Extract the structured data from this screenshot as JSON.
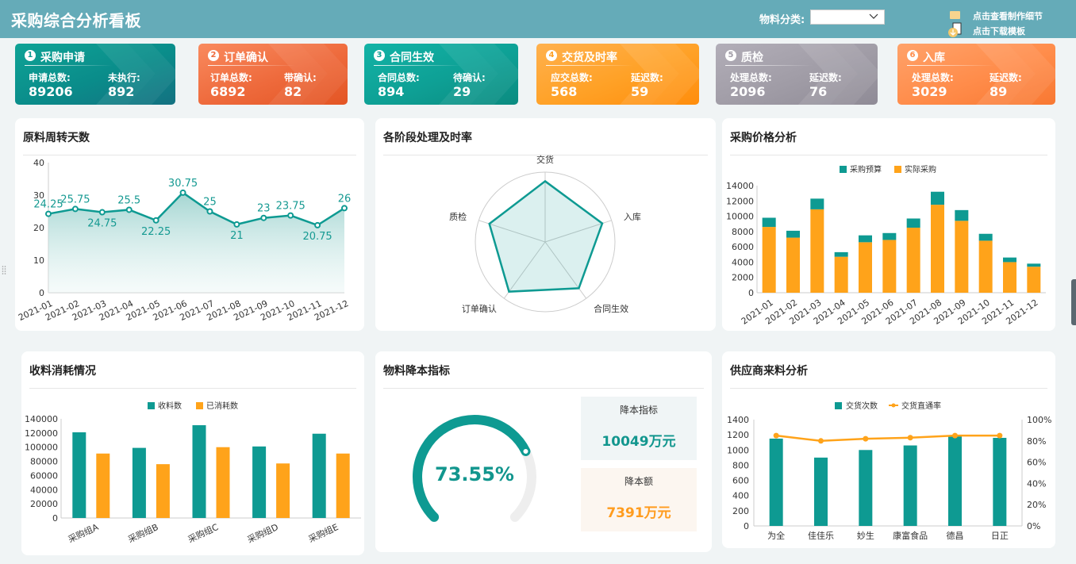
{
  "header": {
    "title": "采购综合分析看板",
    "filter_label": "物料分类:",
    "filter_value": "",
    "link_detail": "点击查看制作细节",
    "link_download": "点击下载模板"
  },
  "kpis": [
    {
      "index": "1",
      "title": "采购申请",
      "label_a": "申请总数:",
      "value_a": "89206",
      "label_b": "未执行:",
      "value_b": "892"
    },
    {
      "index": "2",
      "title": "订单确认",
      "label_a": "订单总数:",
      "value_a": "6892",
      "label_b": "带确认:",
      "value_b": "82"
    },
    {
      "index": "3",
      "title": "合同生效",
      "label_a": "合同总数:",
      "value_a": "894",
      "label_b": "待确认:",
      "value_b": "29"
    },
    {
      "index": "4",
      "title": "交货及时率",
      "label_a": "应交总数:",
      "value_a": "568",
      "label_b": "延迟数:",
      "value_b": "59"
    },
    {
      "index": "5",
      "title": "质检",
      "label_a": "处理总数:",
      "value_a": "2096",
      "label_b": "延迟数:",
      "value_b": "76"
    },
    {
      "index": "6",
      "title": "入库",
      "label_a": "处理总数:",
      "value_a": "3029",
      "label_b": "延迟数:",
      "value_b": "89"
    }
  ],
  "panels": {
    "turnover": "原料周转天数",
    "radar": "各阶段处理及时率",
    "price": "采购价格分析",
    "consumption": "收料消耗情况",
    "costdown": "物料降本指标",
    "supplier": "供应商来料分析"
  },
  "costdown": {
    "gauge_label": "73.55%",
    "target_label": "降本指标",
    "target_value": "10049万元",
    "amount_label": "降本额",
    "amount_value": "7391万元"
  },
  "colors": {
    "teal": "#0e9a92",
    "orange": "#ffa31a",
    "header": "#65abb8"
  },
  "chart_data": [
    {
      "type": "area",
      "x": [
        "2021-01",
        "2021-02",
        "2021-03",
        "2021-04",
        "2021-05",
        "2021-06",
        "2021-07",
        "2021-08",
        "2021-09",
        "2021-10",
        "2021-11",
        "2021-12"
      ],
      "values": [
        24.25,
        25.75,
        24.75,
        25.5,
        22.25,
        30.75,
        25,
        21,
        23,
        23.75,
        20.75,
        26
      ],
      "data_labels": [
        "24.25",
        "25.75",
        "24.75",
        "25.5",
        "22.25",
        "30.75",
        "25",
        "21",
        "23",
        "23.75",
        "20.75",
        "26"
      ],
      "ylim": [
        0,
        40
      ],
      "yticks": [
        0,
        10,
        20,
        30,
        40
      ]
    },
    {
      "type": "radar",
      "axes": [
        "交货",
        "入库",
        "合同生效",
        "订单确认",
        "质检"
      ],
      "values": [
        0.87,
        0.86,
        0.82,
        0.88,
        0.84
      ],
      "range": [
        0,
        1
      ]
    },
    {
      "type": "bar",
      "stacked": true,
      "categories": [
        "2021-01",
        "2021-02",
        "2021-03",
        "2021-04",
        "2021-05",
        "2021-06",
        "2021-07",
        "2021-08",
        "2021-09",
        "2021-10",
        "2021-11",
        "2021-12"
      ],
      "series": [
        {
          "name": "实际采购",
          "values": [
            8600,
            7200,
            10900,
            4700,
            6600,
            6900,
            8500,
            11500,
            9400,
            6800,
            4000,
            3400
          ]
        },
        {
          "name": "采购预算",
          "values": [
            1200,
            900,
            1400,
            600,
            900,
            900,
            1200,
            1700,
            1400,
            900,
            600,
            400
          ]
        }
      ],
      "ylim": [
        0,
        14000
      ],
      "yticks": [
        0,
        2000,
        4000,
        6000,
        8000,
        10000,
        12000,
        14000
      ],
      "legend": [
        "采购预算",
        "实际采购"
      ],
      "legend_position": "top"
    },
    {
      "type": "bar",
      "categories": [
        "采购组A",
        "采购组B",
        "采购组C",
        "采购组D",
        "采购组E"
      ],
      "series": [
        {
          "name": "收料数",
          "values": [
            121000,
            99000,
            131000,
            101000,
            119000
          ]
        },
        {
          "name": "已消耗数",
          "values": [
            91000,
            76000,
            100000,
            77000,
            91000
          ]
        }
      ],
      "ylim": [
        0,
        140000
      ],
      "yticks": [
        0,
        20000,
        40000,
        60000,
        80000,
        100000,
        120000,
        140000
      ],
      "legend_position": "top"
    },
    {
      "type": "gauge",
      "value": 0.7355
    },
    {
      "type": "bar",
      "categories": [
        "为全",
        "佳佳乐",
        "妙生",
        "康富食品",
        "德昌",
        "日正"
      ],
      "series": [
        {
          "name": "交货次数",
          "values": [
            1150,
            900,
            1000,
            1060,
            1180,
            1160
          ]
        },
        {
          "name": "交货直通率",
          "values": [
            0.85,
            0.8,
            0.82,
            0.83,
            0.85,
            0.85
          ],
          "type": "line",
          "axis": "right"
        }
      ],
      "ylim": [
        0,
        1400
      ],
      "yticks": [
        0,
        200,
        400,
        600,
        800,
        1000,
        1200,
        1400
      ],
      "y2ticks": [
        "0%",
        "20%",
        "40%",
        "60%",
        "80%",
        "100%"
      ],
      "legend_position": "top"
    }
  ]
}
